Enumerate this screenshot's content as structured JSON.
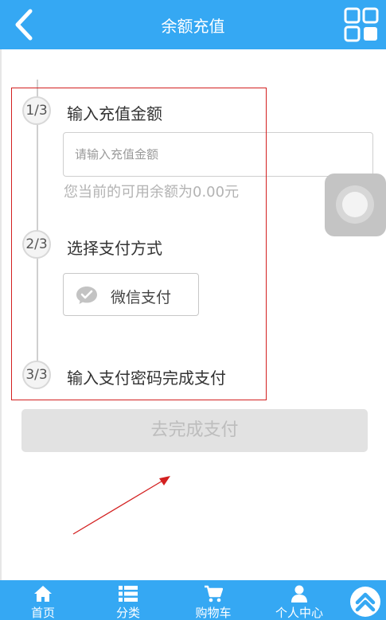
{
  "header": {
    "title": "余额充值",
    "back_icon": "chevron-left-icon",
    "menu_icon": "grid-icon"
  },
  "steps": [
    {
      "index": "1/3",
      "label": "输入充值金额"
    },
    {
      "index": "2/3",
      "label": "选择支付方式"
    },
    {
      "index": "3/3",
      "label": "输入支付密码完成支付"
    }
  ],
  "amount_input": {
    "value": "",
    "placeholder": "请输入充值金额"
  },
  "balance_text": "您当前的可用余额为0.00元",
  "payment_methods": [
    {
      "label": "微信支付",
      "icon": "wechat-icon"
    }
  ],
  "pay_button": {
    "label": "去完成支付"
  },
  "footer": {
    "tabs": [
      {
        "label": "首页",
        "icon": "home-icon"
      },
      {
        "label": "分类",
        "icon": "list-icon"
      },
      {
        "label": "购物车",
        "icon": "cart-icon"
      },
      {
        "label": "个人中心",
        "icon": "user-icon"
      }
    ],
    "top_icon": "chevrons-up-icon"
  },
  "colors": {
    "primary": "#35a8f3",
    "annotation": "#d32020",
    "disabled_button": "#e2e2e2"
  }
}
